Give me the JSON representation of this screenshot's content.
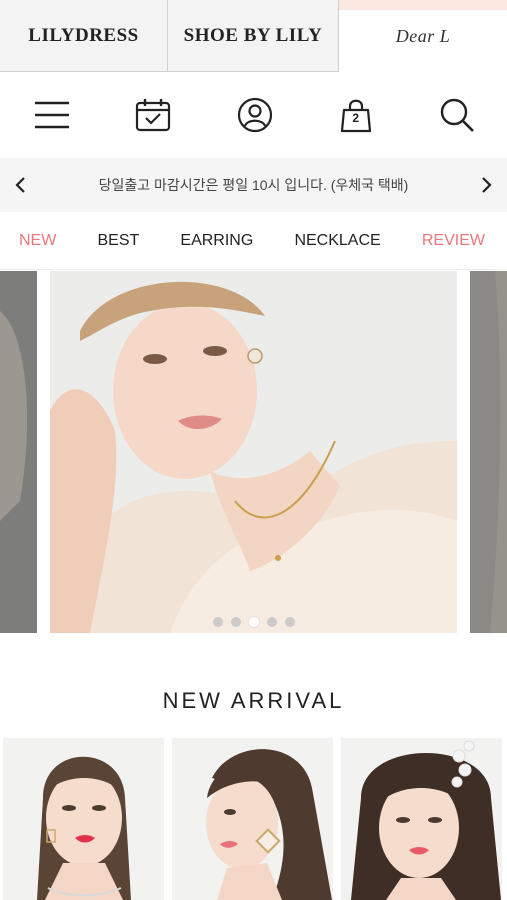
{
  "brand_tabs": [
    {
      "label": "LILYDRESS"
    },
    {
      "label": "SHOE BY LILY"
    },
    {
      "label": "Dear L"
    }
  ],
  "icons": {
    "menu": "hamburger-menu-icon",
    "calendar": "calendar-check-icon",
    "account": "user-icon",
    "cart": "shopping-bag-icon",
    "search": "search-icon"
  },
  "cart": {
    "count": "2"
  },
  "notice": {
    "text": "당일출고 마감시간은 평일 10시 입니다. (우체국 택배)"
  },
  "categories": [
    {
      "label": "NEW"
    },
    {
      "label": "BEST"
    },
    {
      "label": "EARRING"
    },
    {
      "label": "NECKLACE"
    },
    {
      "label": "REVIEW"
    }
  ],
  "colors": {
    "accent": "#e8787b",
    "notice_bg": "#f5f5f5",
    "tab_bg": "#f3f3f3"
  },
  "banner": {
    "slide_count": 5,
    "active_slide": 3
  },
  "section": {
    "title": "NEW ARRIVAL"
  }
}
